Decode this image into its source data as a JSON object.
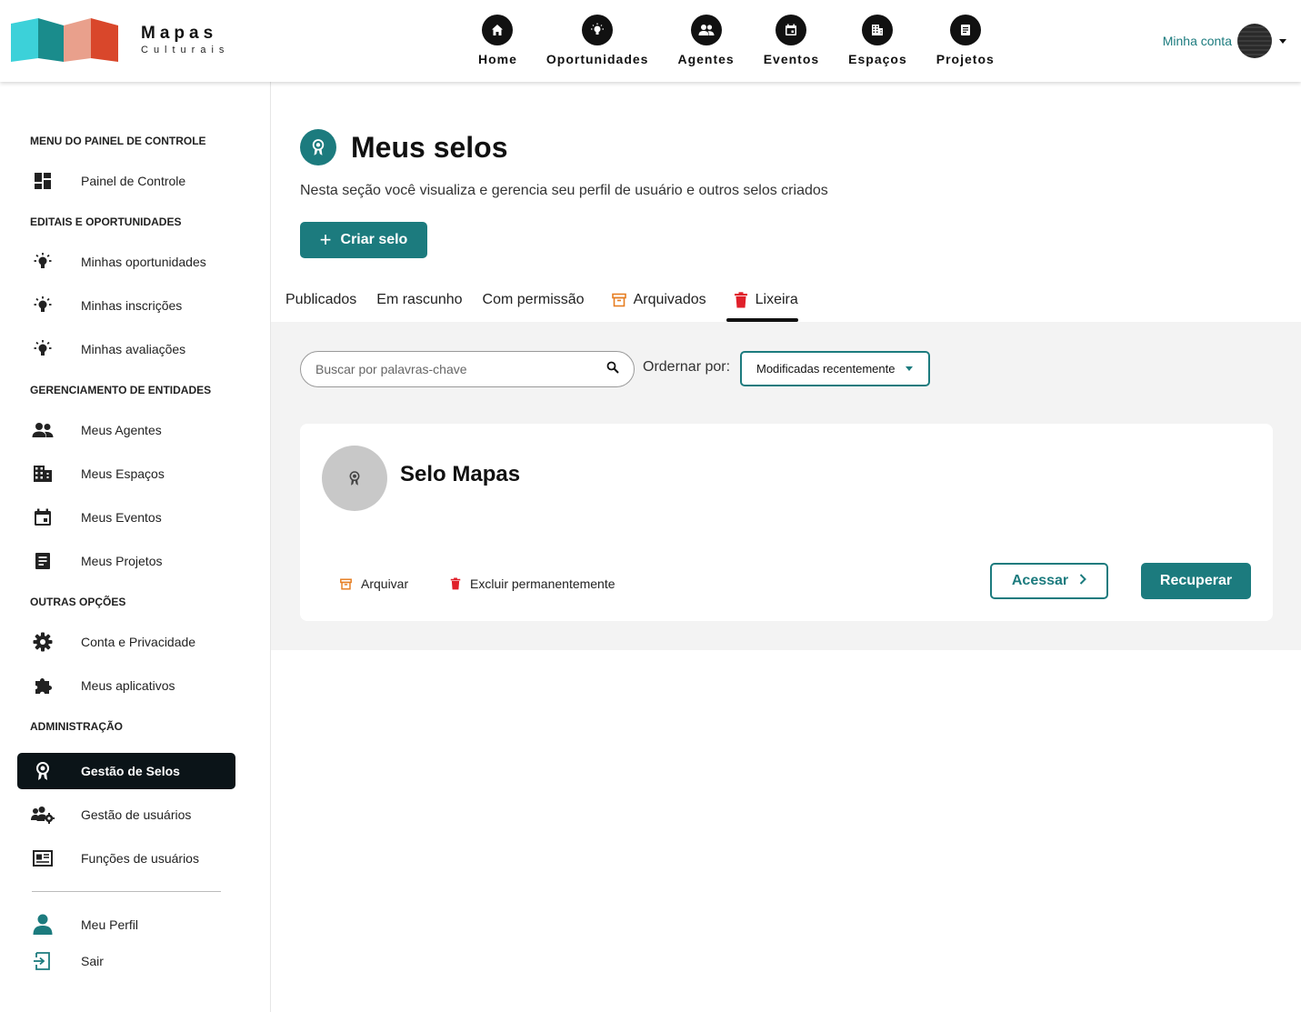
{
  "header": {
    "logo_title": "Mapas",
    "logo_subtitle": "Culturais",
    "nav": [
      {
        "label": "Home",
        "icon": "home-icon"
      },
      {
        "label": "Oportunidades",
        "icon": "lightbulb-icon"
      },
      {
        "label": "Agentes",
        "icon": "people-icon"
      },
      {
        "label": "Eventos",
        "icon": "calendar-icon"
      },
      {
        "label": "Espaços",
        "icon": "building-icon"
      },
      {
        "label": "Projetos",
        "icon": "document-icon"
      }
    ],
    "account_label": "Minha conta"
  },
  "sidebar": {
    "sections": {
      "painel": "MENU DO PAINEL DE CONTROLE",
      "editais": "EDITAIS E OPORTUNIDADES",
      "entidades": "GERENCIAMENTO DE ENTIDADES",
      "outras": "OUTRAS OPÇÕES",
      "admin": "ADMINISTRAÇÃO"
    },
    "items": {
      "painel_controle": "Painel de Controle",
      "minhas_oportunidades": "Minhas oportunidades",
      "minhas_inscricoes": "Minhas inscrições",
      "minhas_avaliacoes": "Minhas avaliações",
      "meus_agentes": "Meus Agentes",
      "meus_espacos": "Meus Espaços",
      "meus_eventos": "Meus Eventos",
      "meus_projetos": "Meus Projetos",
      "conta_privacidade": "Conta e Privacidade",
      "meus_aplicativos": "Meus aplicativos",
      "gestao_selos": "Gestão de Selos",
      "gestao_usuarios": "Gestão de usuários",
      "funcoes_usuarios": "Funções de usuários",
      "meu_perfil": "Meu Perfil",
      "sair": "Sair"
    },
    "active_item": "gestao_selos"
  },
  "main": {
    "title": "Meus selos",
    "description": "Nesta seção você visualiza e gerencia seu perfil de usuário e outros selos criados",
    "create_button": "Criar selo",
    "tabs": [
      {
        "label": "Publicados",
        "icon": null
      },
      {
        "label": "Em rascunho",
        "icon": null
      },
      {
        "label": "Com permissão",
        "icon": null
      },
      {
        "label": "Arquivados",
        "icon": "archive-icon"
      },
      {
        "label": "Lixeira",
        "icon": "trash-icon"
      }
    ],
    "active_tab": "Lixeira",
    "search": {
      "placeholder": "Buscar por palavras-chave",
      "value": ""
    },
    "order_label": "Ordernar por:",
    "order_value": "Modificadas recentemente"
  },
  "card": {
    "title": "Selo Mapas",
    "archive_label": "Arquivar",
    "delete_label": "Excluir permanentemente",
    "access_label": "Acessar",
    "recover_label": "Recuperar"
  },
  "colors": {
    "primary": "#1c7b7e",
    "archive": "#e67e22",
    "trash": "#e0202a",
    "active_bg": "#0b1418"
  }
}
